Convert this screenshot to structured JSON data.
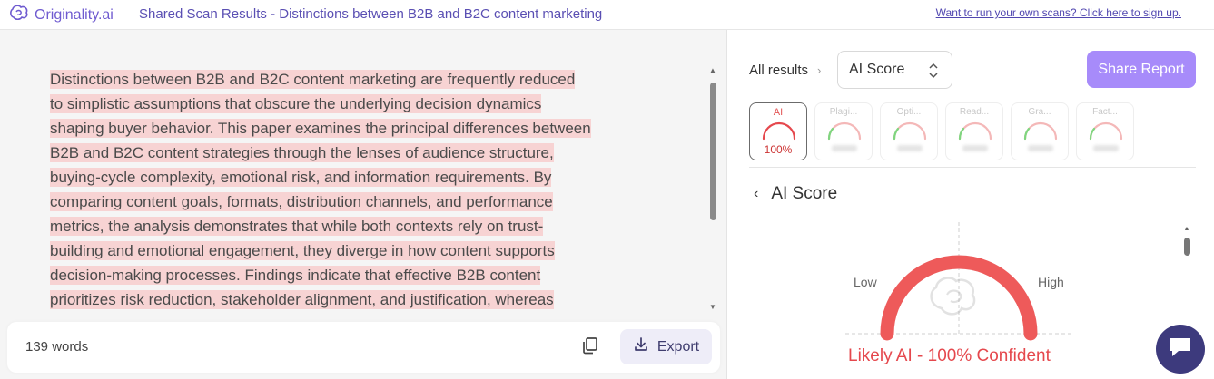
{
  "header": {
    "logo_text": "Originality.ai",
    "logo_icon": "brain-icon",
    "title": "Shared Scan Results - Distinctions between B2B and B2C content marketing",
    "signup_link": "Want to run your own scans? Click here to sign up."
  },
  "document": {
    "lines": [
      "Distinctions between B2B and B2C content marketing are frequently reduced",
      "to simplistic assumptions that obscure the underlying decision dynamics",
      "shaping buyer behavior. This paper examines the principal differences between",
      "B2B and B2C content strategies through the lenses of audience structure,",
      "buying-cycle complexity, emotional risk, and information requirements. By",
      "comparing content goals, formats, distribution channels, and performance",
      "metrics, the analysis demonstrates that while both contexts rely on trust-",
      "building and emotional engagement, they diverge in how content supports",
      "decision-making processes. Findings indicate that effective B2B content",
      "prioritizes risk reduction, stakeholder alignment, and justification, whereas"
    ],
    "highlight_color": "#f7d3d3"
  },
  "footer": {
    "word_count": "139 words",
    "copy_icon": "copy-icon",
    "export_label": "Export",
    "export_icon": "download-icon"
  },
  "results": {
    "breadcrumb_root": "All results",
    "select_value": "AI Score",
    "share_label": "Share Report",
    "tiles": [
      {
        "label": "AI",
        "value": "100%",
        "active": true
      },
      {
        "label": "Plagi...",
        "value": "",
        "active": false
      },
      {
        "label": "Opti...",
        "value": "",
        "active": false
      },
      {
        "label": "Read...",
        "value": "",
        "active": false
      },
      {
        "label": "Gra...",
        "value": "",
        "active": false
      },
      {
        "label": "Fact...",
        "value": "",
        "active": false
      }
    ],
    "section_title": "AI Score",
    "gauge": {
      "low_label": "Low",
      "high_label": "High",
      "ai_score_fraction": 1.0,
      "verdict": "Likely AI - 100% Confident"
    }
  },
  "colors": {
    "brand": "#6f5bd0",
    "accent_button": "#a78bfa",
    "danger": "#e5484d",
    "chat_bubble": "#3d3a7d"
  },
  "chat_icon": "chat-bubble-icon"
}
